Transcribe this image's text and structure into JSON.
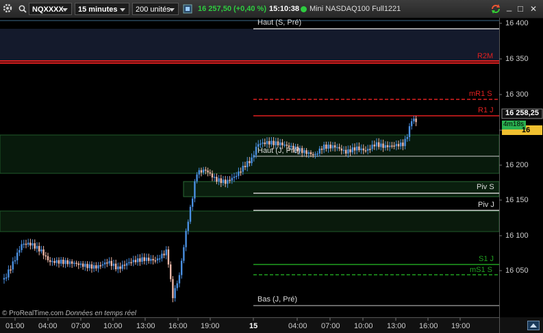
{
  "toolbar": {
    "symbol": "NQXXXX",
    "timeframe": "15 minutes",
    "units": "200 unités",
    "price_change": "16 257,50 (+0,40 %)",
    "clock": "15:10:38",
    "instrument": "Mini NASDAQ100 Full1221",
    "minimize_glyph": "_",
    "maximize_glyph": "□",
    "close_glyph": "✕"
  },
  "colors": {
    "up": "#4a90e2",
    "down": "#f0b8a8",
    "resistance": "#e02020",
    "support": "#20a020",
    "accent_green": "#20c040"
  },
  "price_axis": {
    "ticks": [
      "16 400",
      "16 350",
      "16 300",
      "16 250",
      "16 200",
      "16 150",
      "16 100",
      "16 050"
    ],
    "current_price": "16 258,25",
    "last_price": "16 257,50",
    "countdown": "4m18s"
  },
  "levels": {
    "haut_s": "Haut (S, Pré)",
    "r2m": "R2M",
    "mr1s": "mR1 S",
    "r1j": "R1 J",
    "haut_j": "Haut (J, Pré)",
    "piv_s": "Piv S",
    "piv_j": "Piv J",
    "s1j": "S1 J",
    "ms1s": "mS1 S",
    "bas_j": "Bas (J, Pré)"
  },
  "time_axis": {
    "labels": [
      "01:00",
      "04:00",
      "07:00",
      "10:00",
      "13:00",
      "16:00",
      "19:00",
      "15",
      "04:00",
      "07:00",
      "10:00",
      "13:00",
      "16:00",
      "19:00"
    ]
  },
  "footer": {
    "copyright": "© ProRealTime.com",
    "realtime": "Données en temps réel"
  }
}
